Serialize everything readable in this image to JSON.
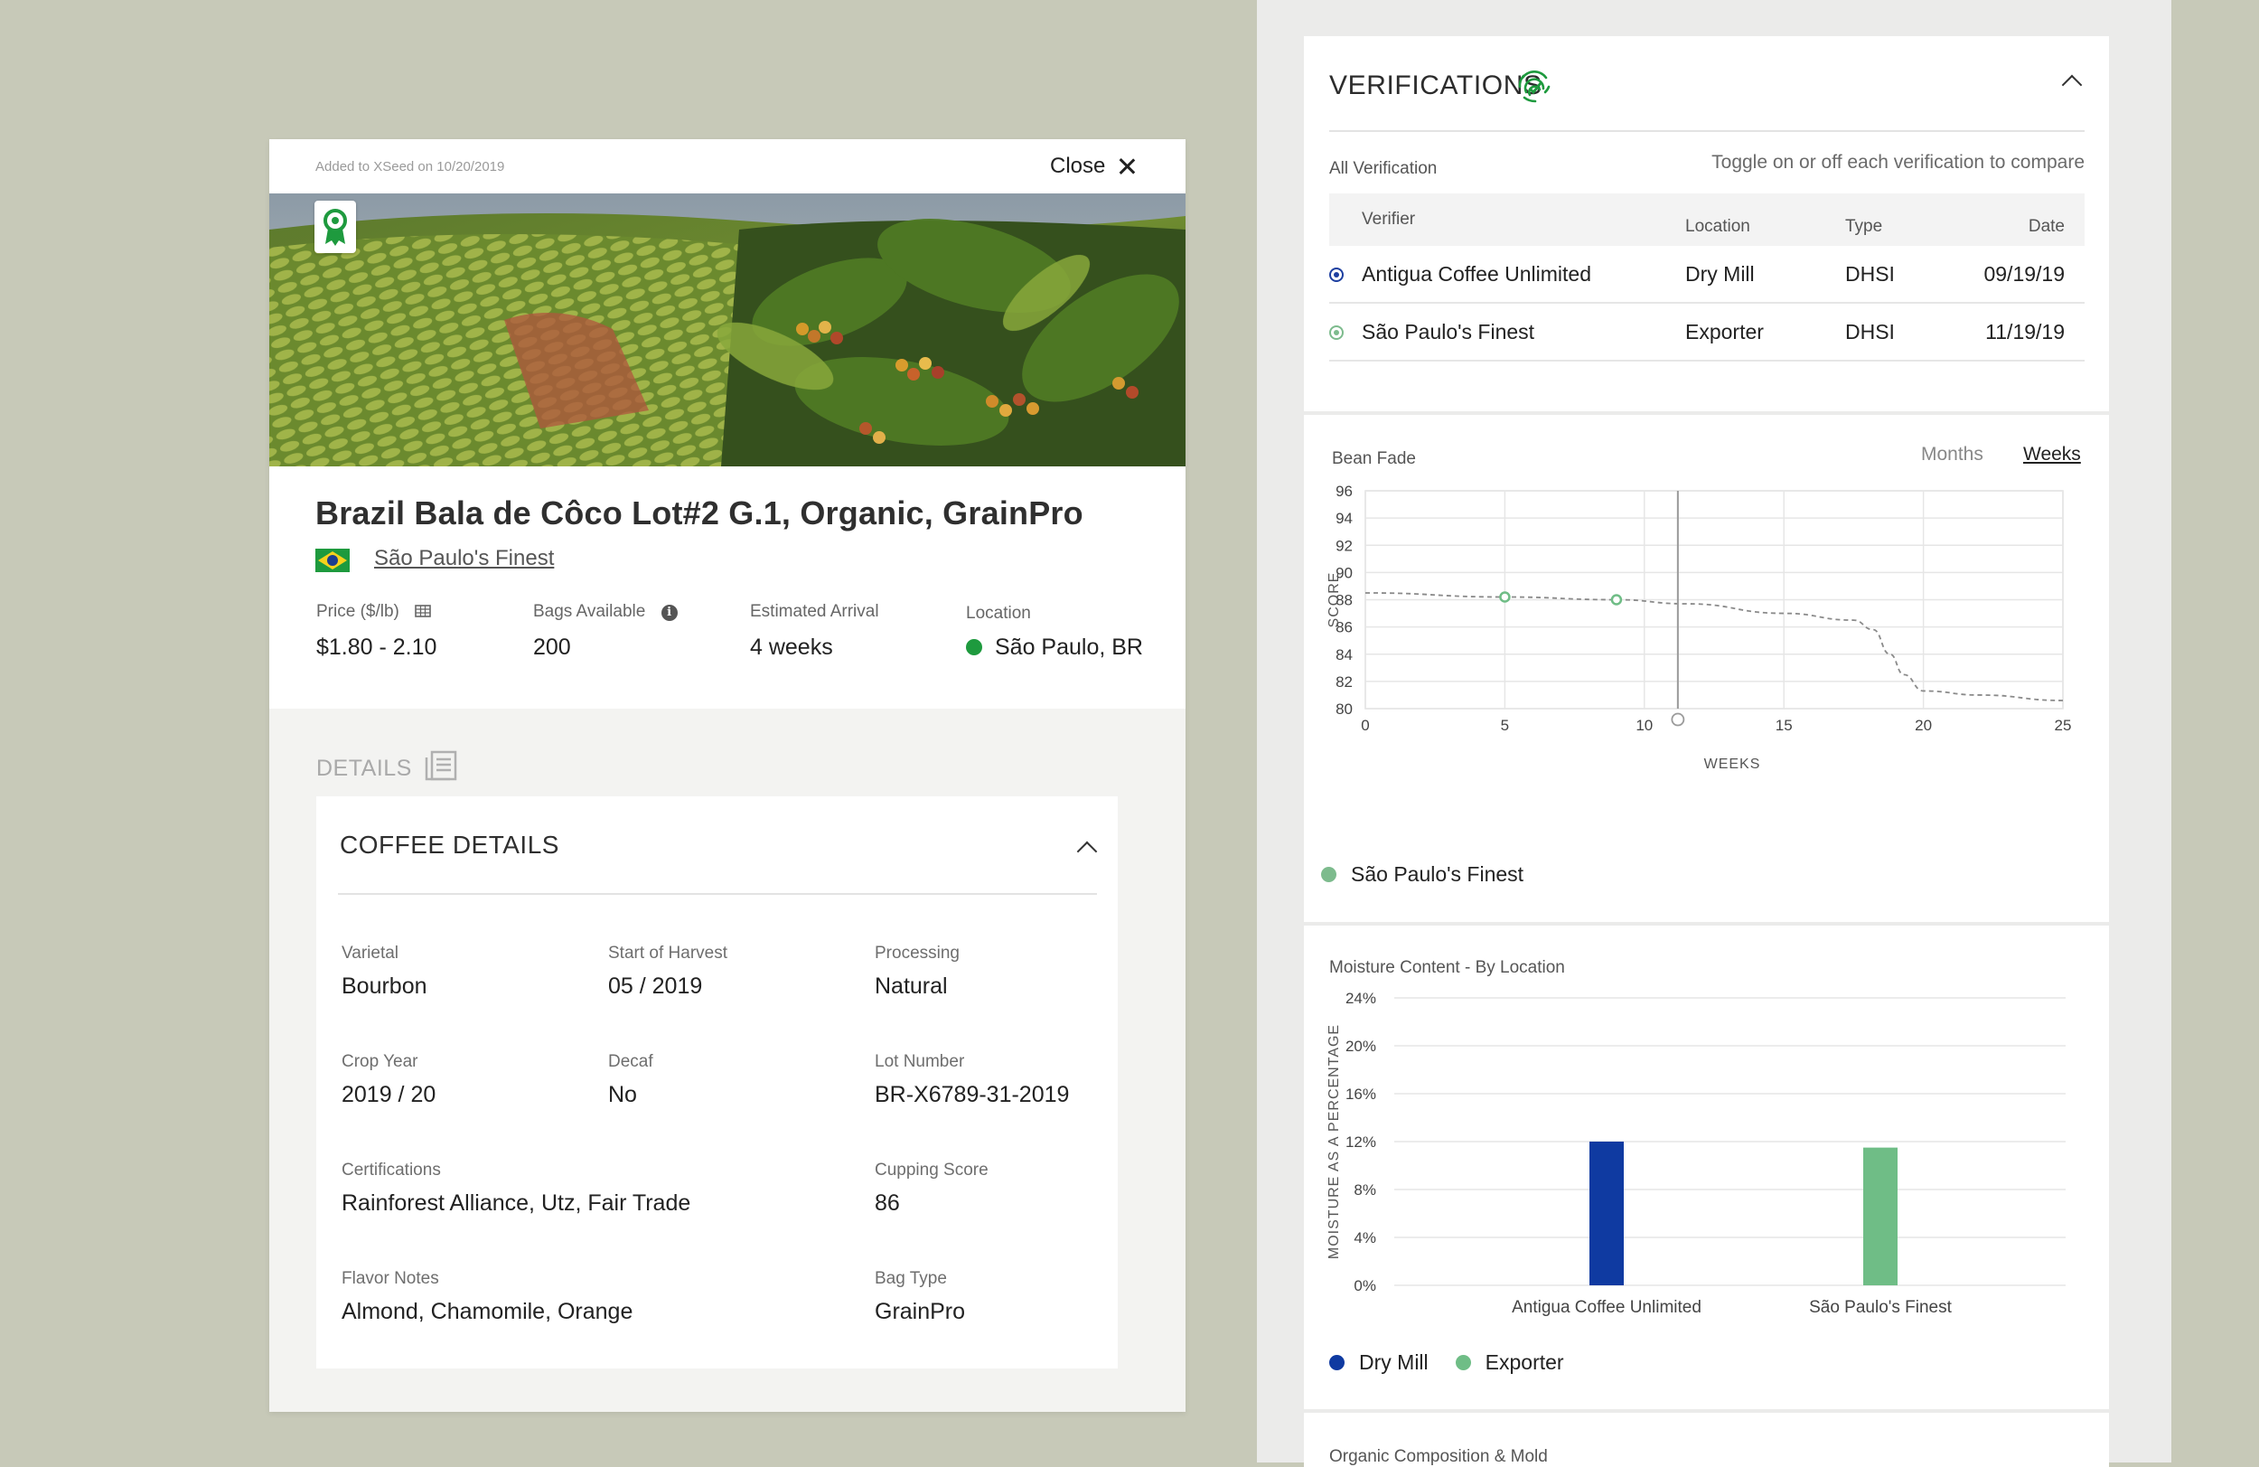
{
  "product_card": {
    "added_text": "Added to XSeed on 10/20/2019",
    "close_label": "Close",
    "title": "Brazil Bala de Côco Lot#2 G.1, Organic, GrainPro",
    "supplier": "São Paulo's Finest",
    "stats": [
      {
        "label": "Price ($/lb)",
        "value": "$1.80 - 2.10"
      },
      {
        "label": "Bags Available",
        "value": "200"
      },
      {
        "label": "Estimated Arrival",
        "value": "4 weeks"
      },
      {
        "label": "Location",
        "value": "São Paulo, BR"
      }
    ]
  },
  "details": {
    "heading": "DETAILS",
    "panel_title": "COFFEE DETAILS",
    "fields": [
      {
        "label": "Varietal",
        "value": "Bourbon"
      },
      {
        "label": "Start of Harvest",
        "value": "05 / 2019"
      },
      {
        "label": "Processing",
        "value": "Natural"
      },
      {
        "label": "Crop Year",
        "value": "2019 / 20"
      },
      {
        "label": "Decaf",
        "value": "No"
      },
      {
        "label": "Lot Number",
        "value": "BR-X6789-31-2019"
      },
      {
        "label": "Certifications",
        "value": "Rainforest Alliance, Utz, Fair Trade"
      },
      {
        "label": "Cupping Score",
        "value": "86"
      },
      {
        "label": "Flavor Notes",
        "value": "Almond, Chamomile, Orange"
      },
      {
        "label": "Bag Type",
        "value": "GrainPro"
      }
    ]
  },
  "verifications": {
    "title": "VERIFICATIONS",
    "all_label": "All Verification",
    "toggle_hint": "Toggle on or off each verification to compare",
    "columns": {
      "verifier": "Verifier",
      "location": "Location",
      "type": "Type",
      "date": "Date"
    },
    "rows": [
      {
        "verifier": "Antigua Coffee Unlimited",
        "location": "Dry Mill",
        "type": "DHSI",
        "date": "09/19/19"
      },
      {
        "verifier": "São Paulo's Finest",
        "location": "Exporter",
        "type": "DHSI",
        "date": "11/19/19"
      }
    ]
  },
  "bean_fade": {
    "label": "Bean Fade",
    "tabs": {
      "months": "Months",
      "weeks": "Weeks"
    },
    "active_tab": "Weeks",
    "legend": "São Paulo's Finest"
  },
  "moisture": {
    "label": "Moisture Content - By Location",
    "legend": {
      "dry_mill": "Dry Mill",
      "exporter": "Exporter"
    }
  },
  "organic": {
    "label": "Organic Composition & Mold"
  },
  "colors": {
    "dry_mill": "#0f3aa1",
    "exporter": "#6fbd86",
    "accent_green": "#1e9a3e"
  },
  "chart_data": [
    {
      "type": "line",
      "ylabel": "SCORE",
      "xlabel": "WEEKS",
      "xlim": [
        0,
        25
      ],
      "ylim": [
        80,
        96
      ],
      "x_ticks": [
        0,
        5,
        10,
        15,
        20,
        25
      ],
      "y_ticks": [
        80,
        82,
        84,
        86,
        88,
        90,
        92,
        94,
        96
      ],
      "grid": true,
      "series": [
        {
          "name": "São Paulo's Finest",
          "x": [
            0,
            5,
            9,
            11.5,
            15,
            17.5,
            18.2,
            18.8,
            19.3,
            20,
            22,
            25
          ],
          "y": [
            88.5,
            88.2,
            88,
            87.7,
            87,
            86.5,
            85.8,
            84,
            82.5,
            81.3,
            81,
            80.6
          ],
          "markers": [
            {
              "x": 5,
              "y": 88.2
            },
            {
              "x": 9,
              "y": 88.0
            }
          ]
        }
      ],
      "marker_line_x": 11.2,
      "legend": "bottom-left"
    },
    {
      "type": "bar",
      "ylabel": "MOISTURE AS A PERCENTAGE",
      "categories": [
        "Antigua Coffee Unlimited",
        "São Paulo's Finest"
      ],
      "y_ticks": [
        "0%",
        "4%",
        "8%",
        "12%",
        "16%",
        "20%",
        "24%"
      ],
      "ylim": [
        0,
        24
      ],
      "series": [
        {
          "name": "Dry Mill",
          "values": [
            12,
            null
          ]
        },
        {
          "name": "Exporter",
          "values": [
            null,
            11.5
          ]
        }
      ],
      "grid": true,
      "legend": "bottom-left"
    }
  ]
}
